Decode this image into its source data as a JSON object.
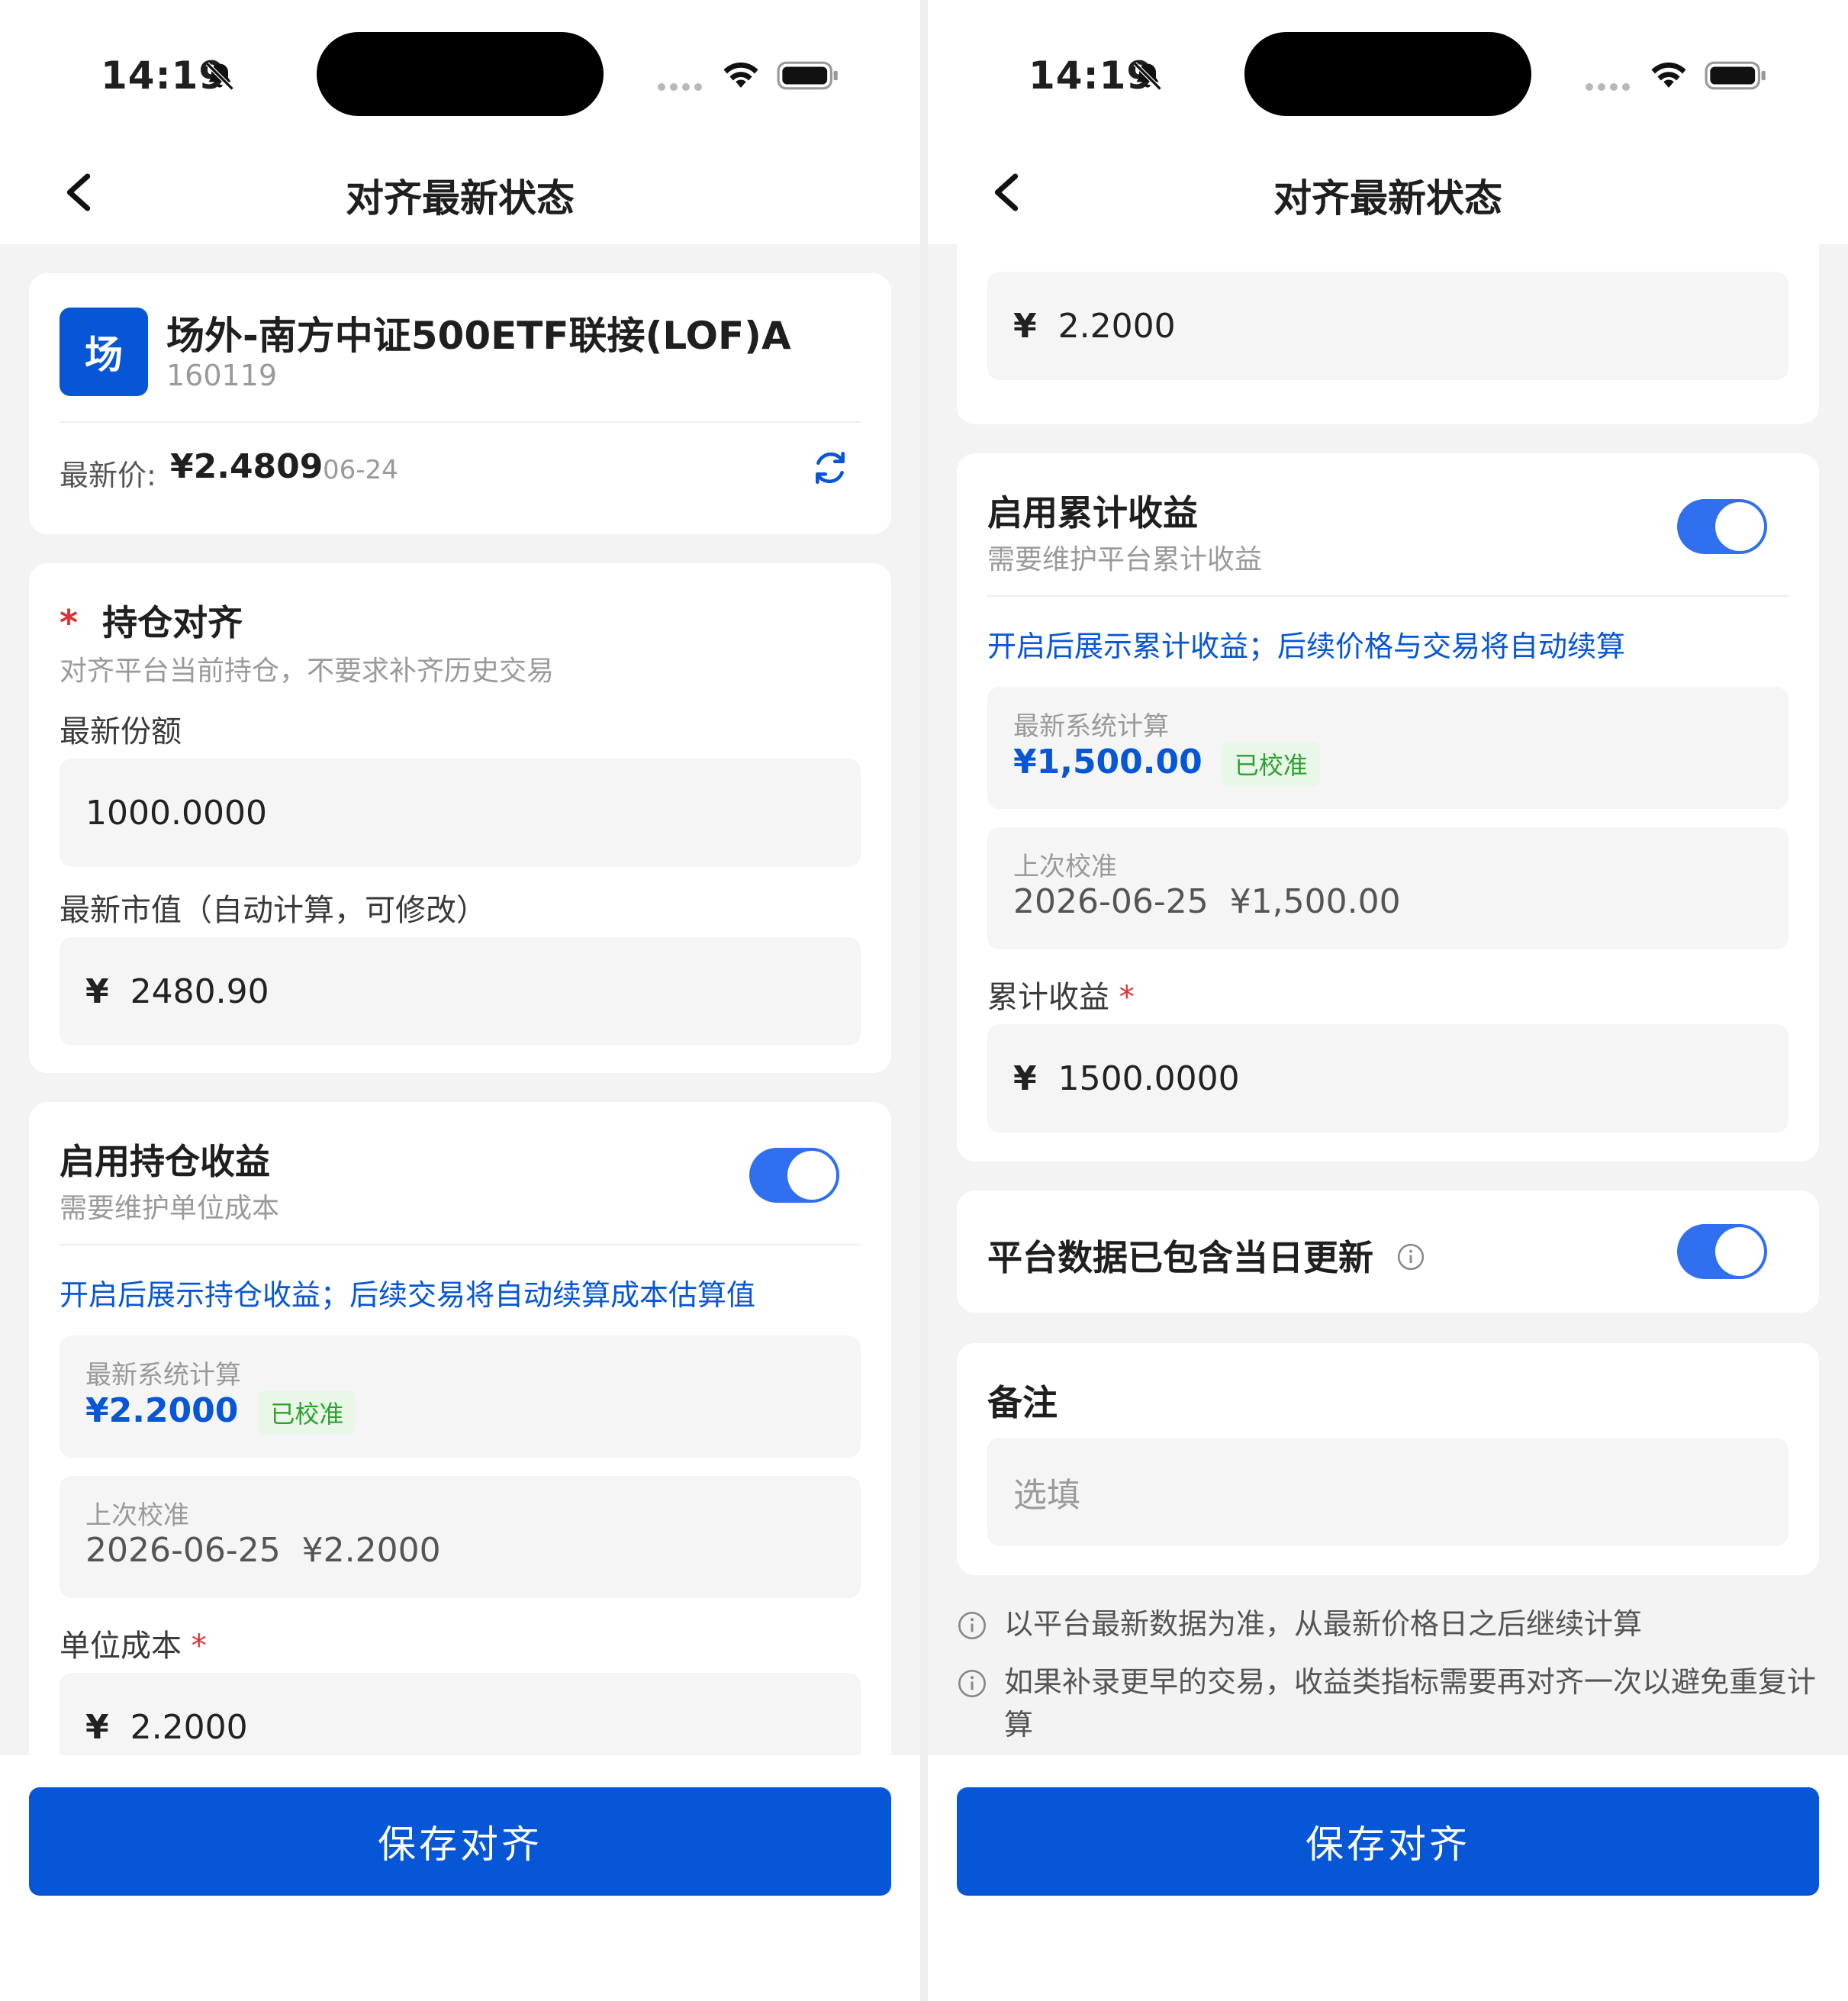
{
  "status_bar": {
    "time": "14:19"
  },
  "nav": {
    "title": "对齐最新状态"
  },
  "fund": {
    "icon_char": "场",
    "name": "场外-南方中证500ETF联接(LOF)A",
    "code": "160119",
    "latest_price_label": "最新价:",
    "latest_price": "¥2.4809",
    "price_date": "06-24"
  },
  "holding": {
    "required_mark": "*",
    "title": "持仓对齐",
    "subtitle": "对齐平台当前持仓，不要求补齐历史交易",
    "shares_label": "最新份额",
    "shares_value": "1000.0000",
    "market_value_label": "最新市值（自动计算，可修改）",
    "currency": "¥",
    "market_value": "2480.90"
  },
  "position_profit": {
    "title": "启用持仓收益",
    "subtitle": "需要维护单位成本",
    "enabled": true,
    "info": "开启后展示持仓收益；后续交易将自动续算成本估算值",
    "system_calc_label": "最新系统计算",
    "system_calc_value": "¥2.2000",
    "badge": "已校准",
    "last_calib_label": "上次校准",
    "last_calib_value": "2026-06-25  ¥2.2000",
    "unit_cost_label": "单位成本",
    "required_mark": "*",
    "currency": "¥",
    "unit_cost_value": "2.2000"
  },
  "cumulative_profit": {
    "title": "启用累计收益",
    "subtitle": "需要维护平台累计收益",
    "enabled": true,
    "info": "开启后展示累计收益；后续价格与交易将自动续算",
    "system_calc_label": "最新系统计算",
    "system_calc_value": "¥1,500.00",
    "badge": "已校准",
    "last_calib_label": "上次校准",
    "last_calib_value": "2026-06-25  ¥1,500.00",
    "cum_label": "累计收益",
    "required_mark": "*",
    "currency": "¥",
    "cum_value": "1500.0000"
  },
  "platform_update": {
    "label": "平台数据已包含当日更新",
    "enabled": true
  },
  "remark": {
    "title": "备注",
    "placeholder": "选填"
  },
  "notes": [
    "以平台最新数据为准，从最新价格日之后继续计算",
    "如果补录更早的交易，收益类指标需要再对齐一次以避免重复计算"
  ],
  "save_button": "保存对齐",
  "colors": {
    "primary": "#0656d6",
    "toggle_on": "#2f6ff0",
    "badge_green": "#2fa02f",
    "required_red": "#e03030"
  }
}
